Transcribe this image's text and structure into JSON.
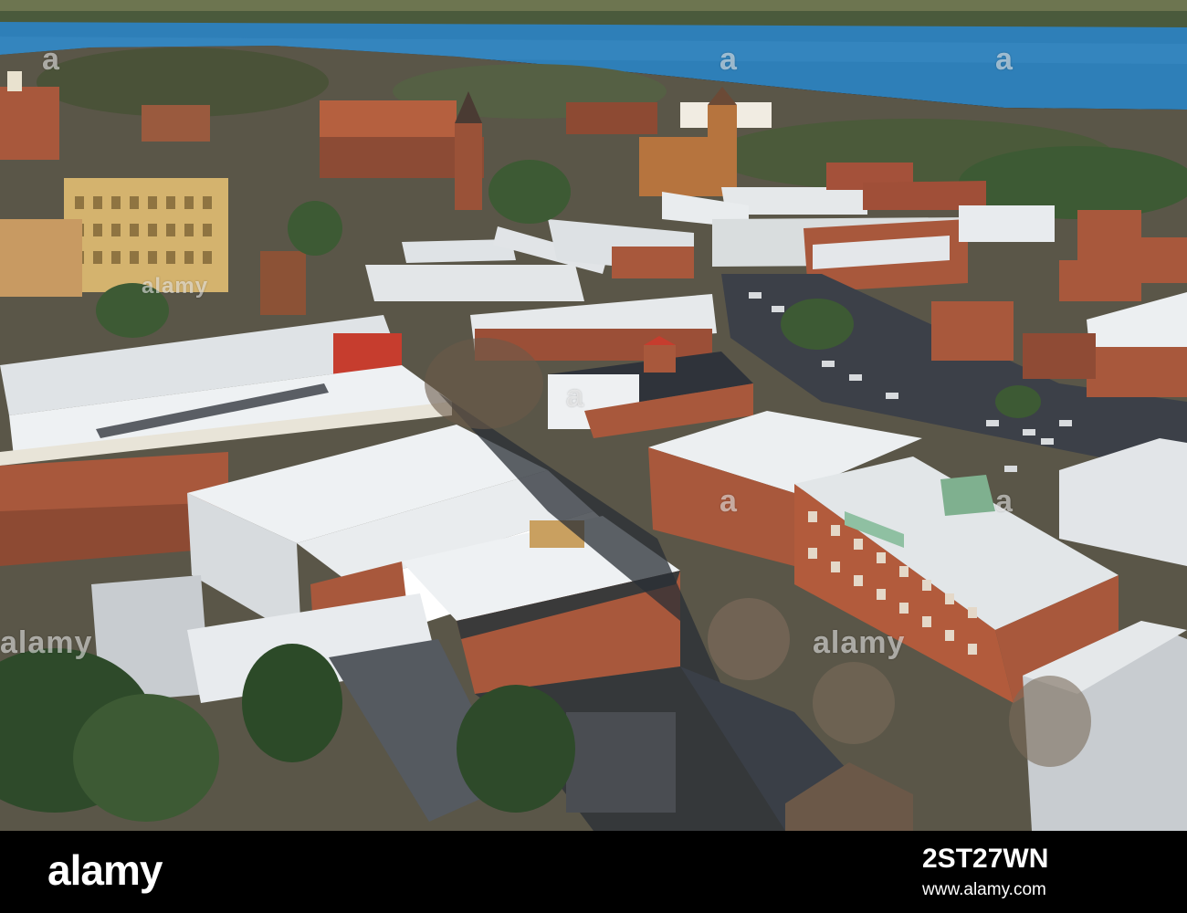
{
  "watermarks": {
    "top_left": "a",
    "top_center": "a",
    "top_right": "a",
    "upper_strip": "alamy",
    "middle_left": "alamy",
    "middle_right": "alamy",
    "lower_left": "a",
    "lower_center": "a",
    "lower_right": "a"
  },
  "footer": {
    "logo": "alamy",
    "image_id": "2ST27WN",
    "site": "www.alamy.com"
  },
  "colors": {
    "water": "#2e7fb8",
    "brick": "#a8583c",
    "roof": "#e8ecef",
    "shadow": "#2a2f36",
    "trees": "#3d5a34"
  }
}
